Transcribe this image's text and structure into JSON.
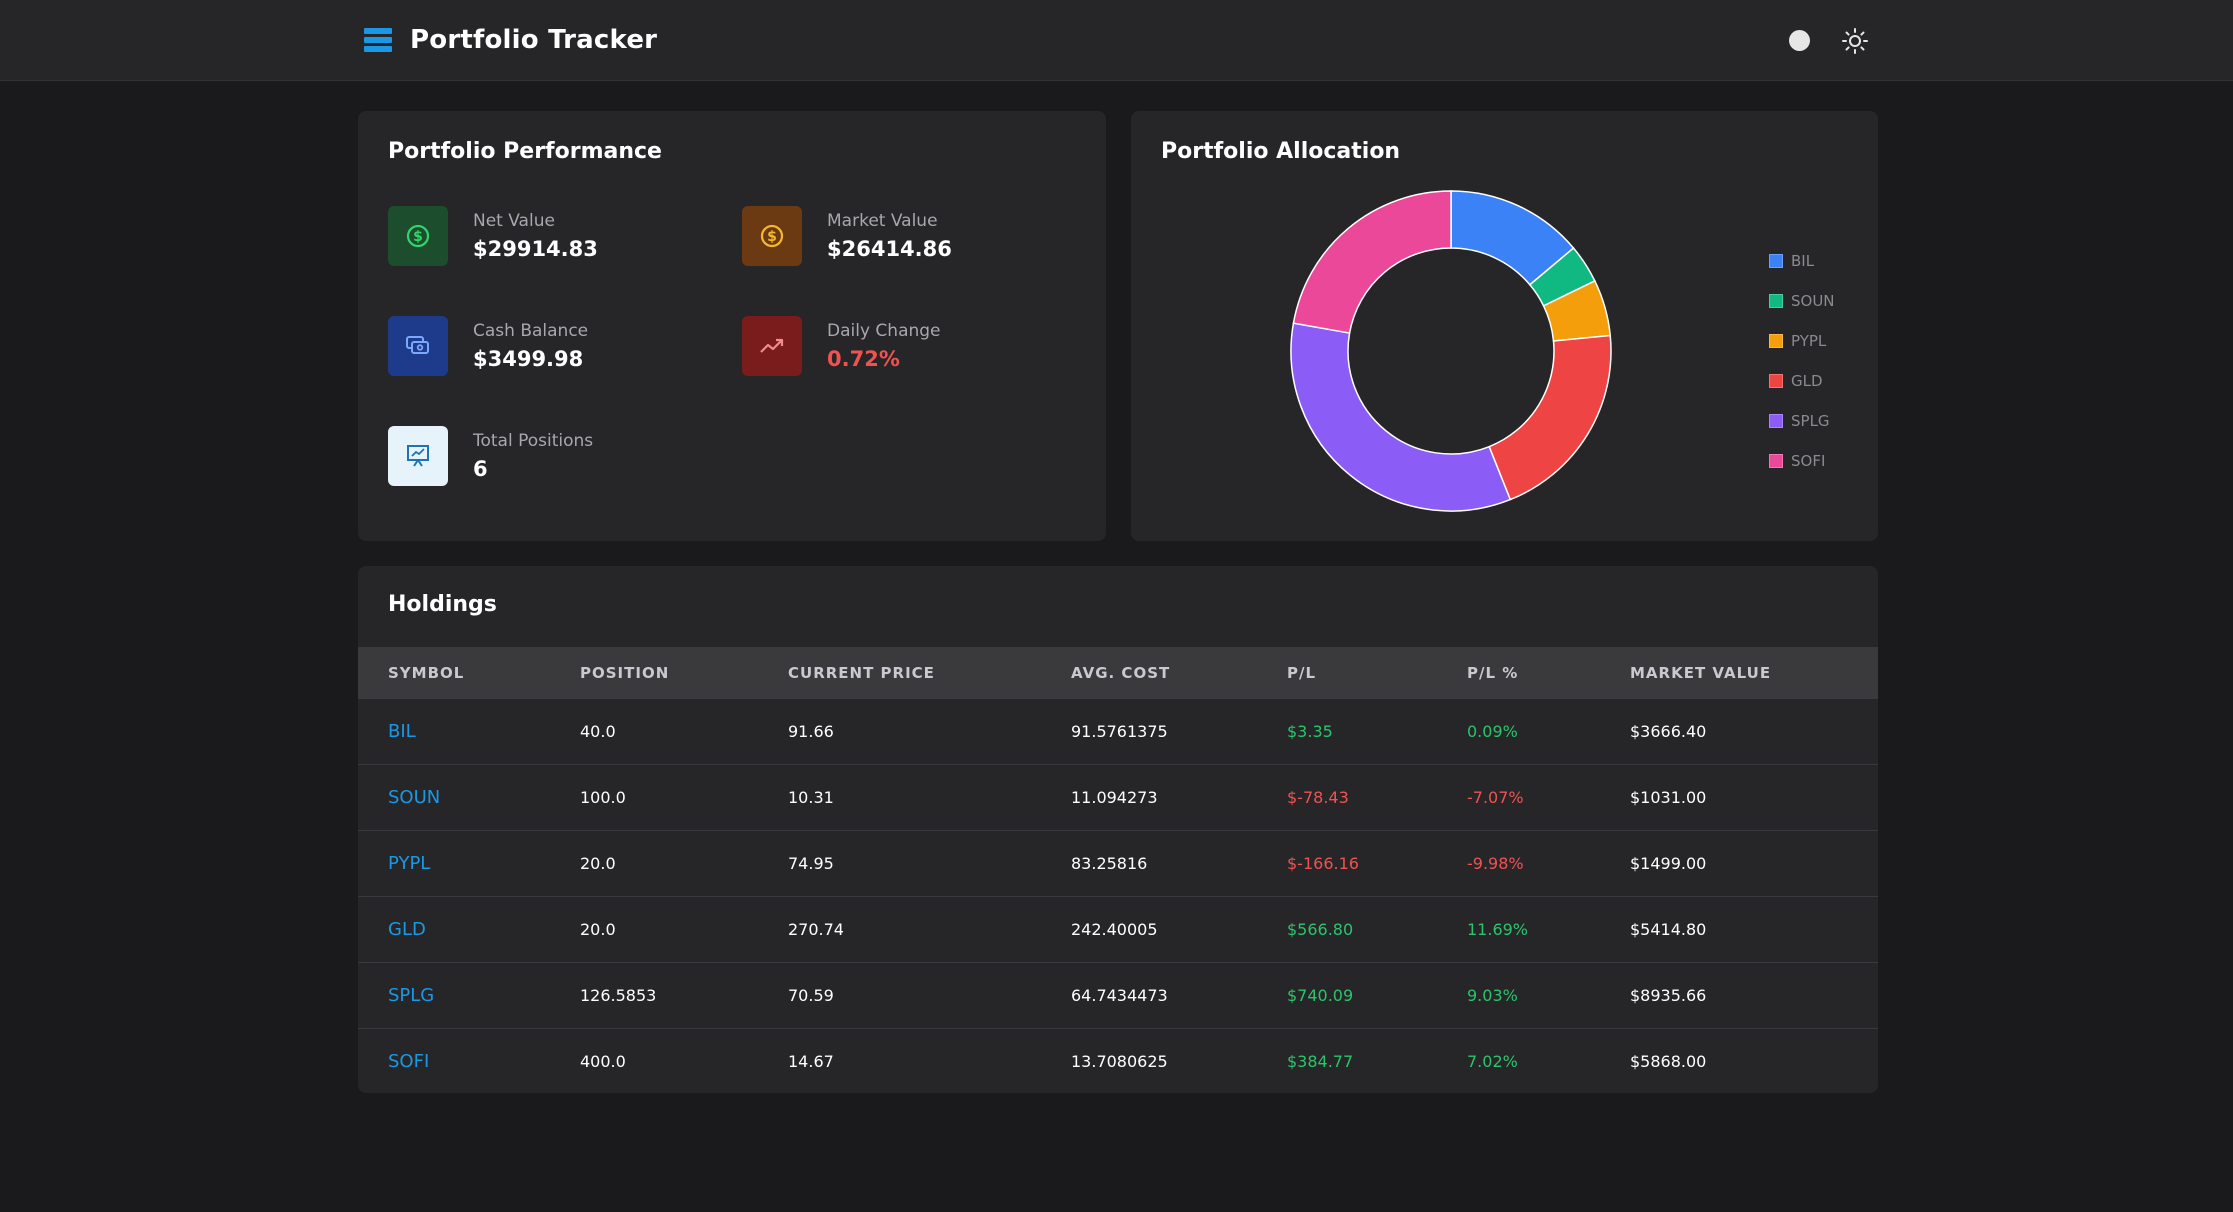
{
  "header": {
    "title": "Portfolio Tracker"
  },
  "performance": {
    "title": "Portfolio Performance",
    "net_value": {
      "label": "Net Value",
      "value": "$29914.83"
    },
    "market_value": {
      "label": "Market Value",
      "value": "$26414.86"
    },
    "cash_balance": {
      "label": "Cash Balance",
      "value": "$3499.98"
    },
    "daily_change": {
      "label": "Daily Change",
      "value": "0.72%"
    },
    "total_positions": {
      "label": "Total Positions",
      "value": "6"
    }
  },
  "allocation": {
    "title": "Portfolio Allocation",
    "legend": [
      {
        "label": "BIL",
        "color": "#3b82f6"
      },
      {
        "label": "SOUN",
        "color": "#10b981"
      },
      {
        "label": "PYPL",
        "color": "#f59e0b"
      },
      {
        "label": "GLD",
        "color": "#ef4444"
      },
      {
        "label": "SPLG",
        "color": "#8b5cf6"
      },
      {
        "label": "SOFI",
        "color": "#ec4899"
      }
    ]
  },
  "chart_data": {
    "type": "pie",
    "categories": [
      "BIL",
      "SOUN",
      "PYPL",
      "GLD",
      "SPLG",
      "SOFI"
    ],
    "values": [
      3666.4,
      1031.0,
      1499.0,
      5414.8,
      8935.66,
      5868.0
    ],
    "colors": [
      "#3b82f6",
      "#10b981",
      "#f59e0b",
      "#ef4444",
      "#8b5cf6",
      "#ec4899"
    ],
    "legend_position": "right"
  },
  "holdings": {
    "title": "Holdings",
    "columns": [
      "SYMBOL",
      "POSITION",
      "CURRENT PRICE",
      "AVG. COST",
      "P/L",
      "P/L %",
      "MARKET VALUE"
    ],
    "rows": [
      {
        "symbol": "BIL",
        "position": "40.0",
        "price": "91.66",
        "avg_cost": "91.5761375",
        "pl": "$3.35",
        "pl_pct": "0.09%",
        "market_value": "$3666.40",
        "trend": "up"
      },
      {
        "symbol": "SOUN",
        "position": "100.0",
        "price": "10.31",
        "avg_cost": "11.094273",
        "pl": "$-78.43",
        "pl_pct": "-7.07%",
        "market_value": "$1031.00",
        "trend": "down"
      },
      {
        "symbol": "PYPL",
        "position": "20.0",
        "price": "74.95",
        "avg_cost": "83.25816",
        "pl": "$-166.16",
        "pl_pct": "-9.98%",
        "market_value": "$1499.00",
        "trend": "down"
      },
      {
        "symbol": "GLD",
        "position": "20.0",
        "price": "270.74",
        "avg_cost": "242.40005",
        "pl": "$566.80",
        "pl_pct": "11.69%",
        "market_value": "$5414.80",
        "trend": "up"
      },
      {
        "symbol": "SPLG",
        "position": "126.5853",
        "price": "70.59",
        "avg_cost": "64.7434473",
        "pl": "$740.09",
        "pl_pct": "9.03%",
        "market_value": "$8935.66",
        "trend": "up"
      },
      {
        "symbol": "SOFI",
        "position": "400.0",
        "price": "14.67",
        "avg_cost": "13.7080625",
        "pl": "$384.77",
        "pl_pct": "7.02%",
        "market_value": "$5868.00",
        "trend": "up"
      }
    ]
  }
}
